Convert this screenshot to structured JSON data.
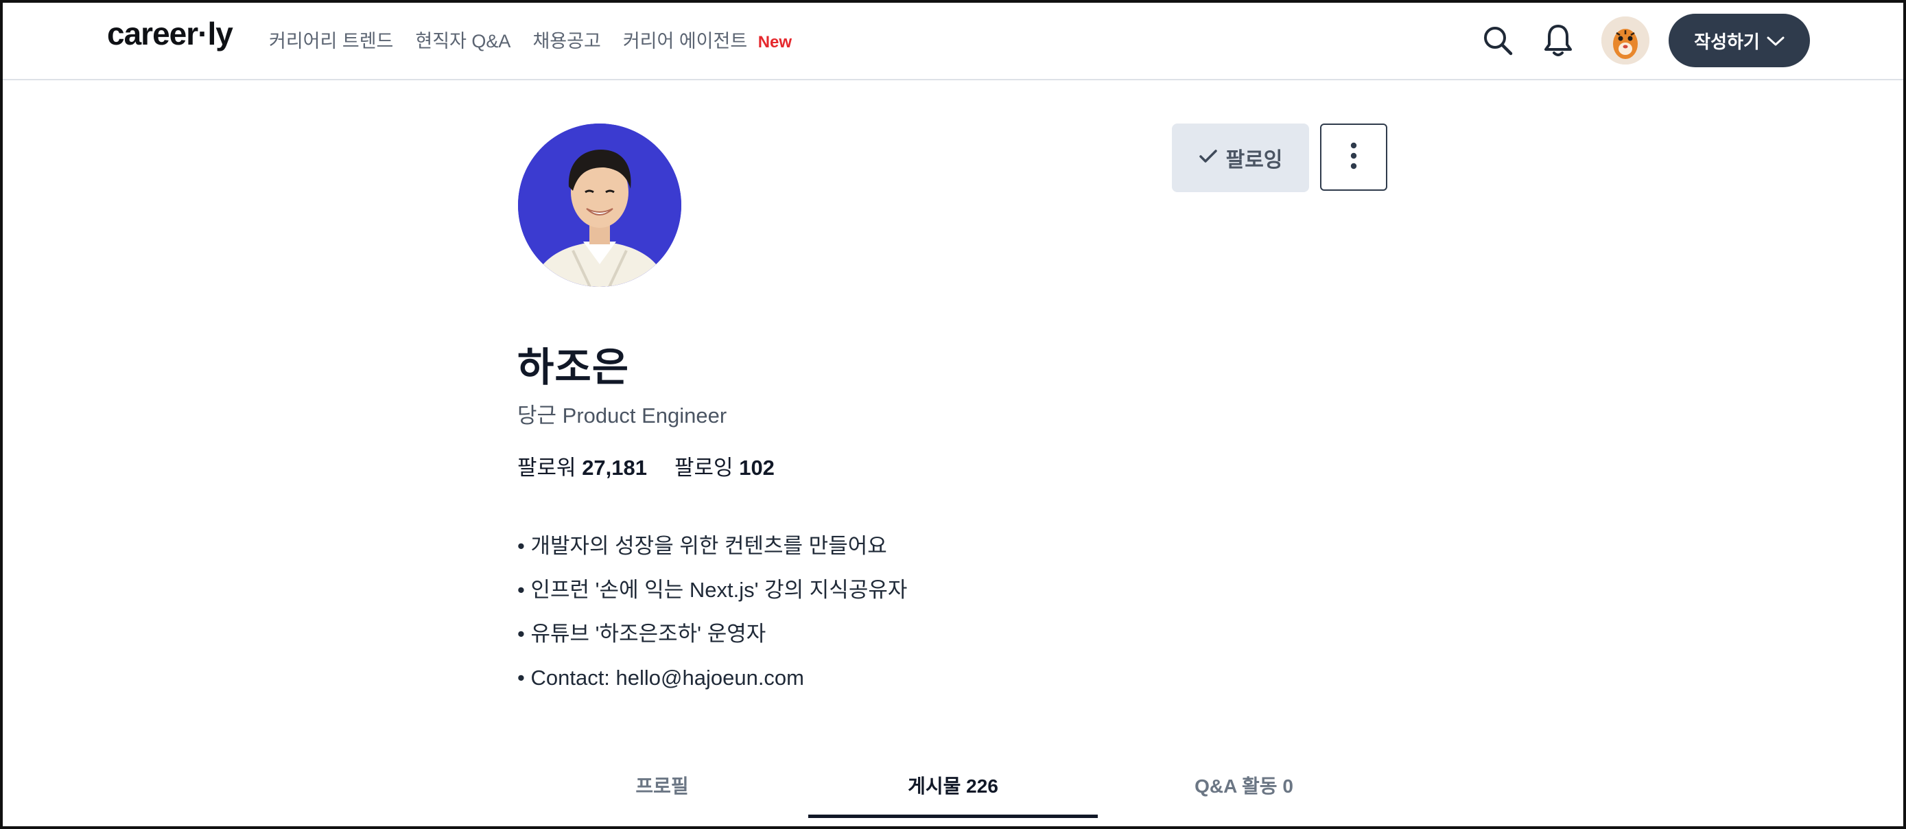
{
  "header": {
    "logo": "career·ly",
    "nav": [
      {
        "label": "커리어리 트렌드"
      },
      {
        "label": "현직자 Q&A"
      },
      {
        "label": "채용공고"
      },
      {
        "label": "커리어 에이전트"
      }
    ],
    "nav_badge": "New",
    "write_button": "작성하기"
  },
  "profile": {
    "name": "하조은",
    "job": "당근 Product Engineer",
    "follow_button": "팔로잉",
    "followers_label": "팔로워",
    "followers_count": "27,181",
    "following_label": "팔로잉",
    "following_count": "102",
    "bio": [
      "• 개발자의 성장을 위한 컨텐츠를 만들어요",
      "• 인프런 '손에 익는 Next.js' 강의 지식공유자",
      "• 유튜브 '하조은조하' 운영자",
      "• Contact: hello@hajoeun.com"
    ]
  },
  "tabs": [
    {
      "label": "프로필",
      "active": false
    },
    {
      "label": "게시물 226",
      "active": true
    },
    {
      "label": "Q&A 활동 0",
      "active": false
    }
  ],
  "icons": [
    "search-icon",
    "bell-icon",
    "chevron-down-icon",
    "check-icon",
    "more-vertical-icon"
  ],
  "colors": {
    "primary_dark": "#2f3b4c",
    "new_badge": "#e5282d",
    "avatar_bg": "#3b3bd0"
  }
}
